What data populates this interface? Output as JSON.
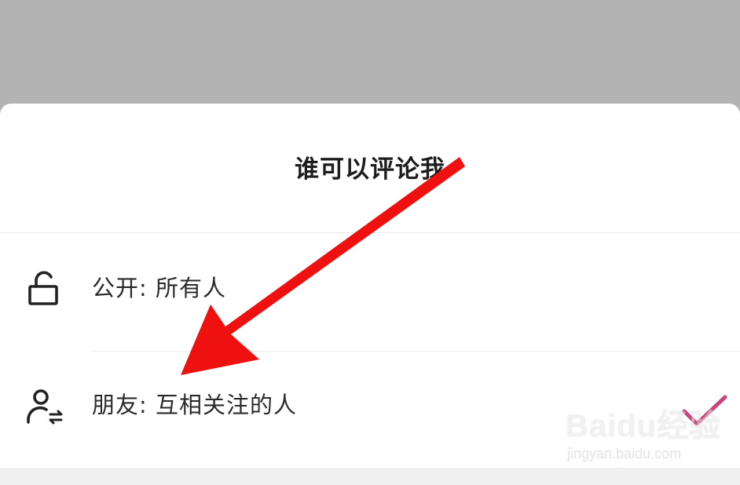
{
  "sheet": {
    "title": "谁可以评论我"
  },
  "options": [
    {
      "label": "公开: 所有人",
      "icon": "unlock-icon",
      "selected": false
    },
    {
      "label": "朋友: 互相关注的人",
      "icon": "mutual-follow-icon",
      "selected": true
    }
  ],
  "watermark": {
    "brand": "Baidu经验",
    "url": "jingyan.baidu.com"
  },
  "colors": {
    "backdrop": "#b3b3b3",
    "check": "#c8457a",
    "arrow": "#ef1010"
  }
}
